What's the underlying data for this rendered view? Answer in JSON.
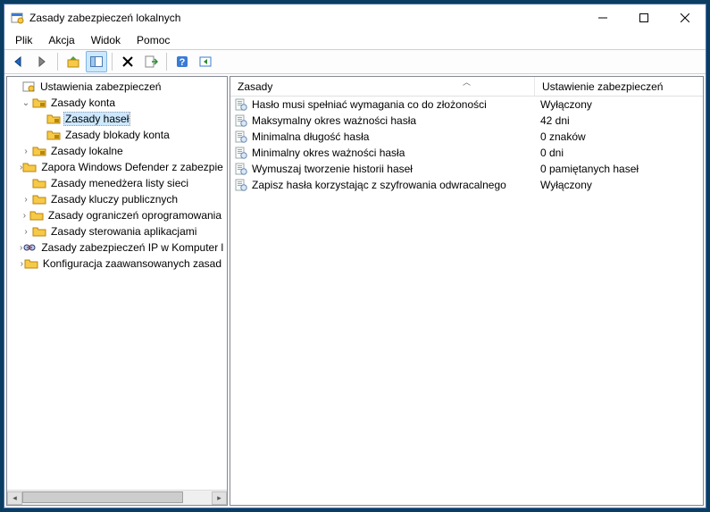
{
  "window": {
    "title": "Zasady zabezpieczeń lokalnych"
  },
  "menu": {
    "file": "Plik",
    "action": "Akcja",
    "view": "Widok",
    "help": "Pomoc"
  },
  "tree": {
    "root": "Ustawienia zabezpieczeń",
    "account_policies": "Zasady konta",
    "password_policy": "Zasady haseł",
    "lockout_policy": "Zasady blokady konta",
    "local_policies": "Zasady lokalne",
    "defender_firewall": "Zapora Windows Defender z zabezpie",
    "network_list": "Zasady menedżera listy sieci",
    "public_key": "Zasady kluczy publicznych",
    "software_restriction": "Zasady ograniczeń oprogramowania",
    "app_control": "Zasady sterowania aplikacjami",
    "ip_sec": "Zasady zabezpieczeń IP w Komputer l",
    "advanced_audit": "Konfiguracja zaawansowanych zasad"
  },
  "columns": {
    "policy": "Zasady",
    "setting": "Ustawienie zabezpieczeń"
  },
  "rows": [
    {
      "name": "Hasło musi spełniać wymagania co do złożoności",
      "value": "Wyłączony"
    },
    {
      "name": "Maksymalny okres ważności hasła",
      "value": "42 dni"
    },
    {
      "name": "Minimalna długość hasła",
      "value": "0 znaków"
    },
    {
      "name": "Minimalny okres ważności hasła",
      "value": "0 dni"
    },
    {
      "name": "Wymuszaj tworzenie historii haseł",
      "value": "0 pamiętanych haseł"
    },
    {
      "name": "Zapisz hasła korzystając z szyfrowania odwracalnego",
      "value": "Wyłączony"
    }
  ]
}
